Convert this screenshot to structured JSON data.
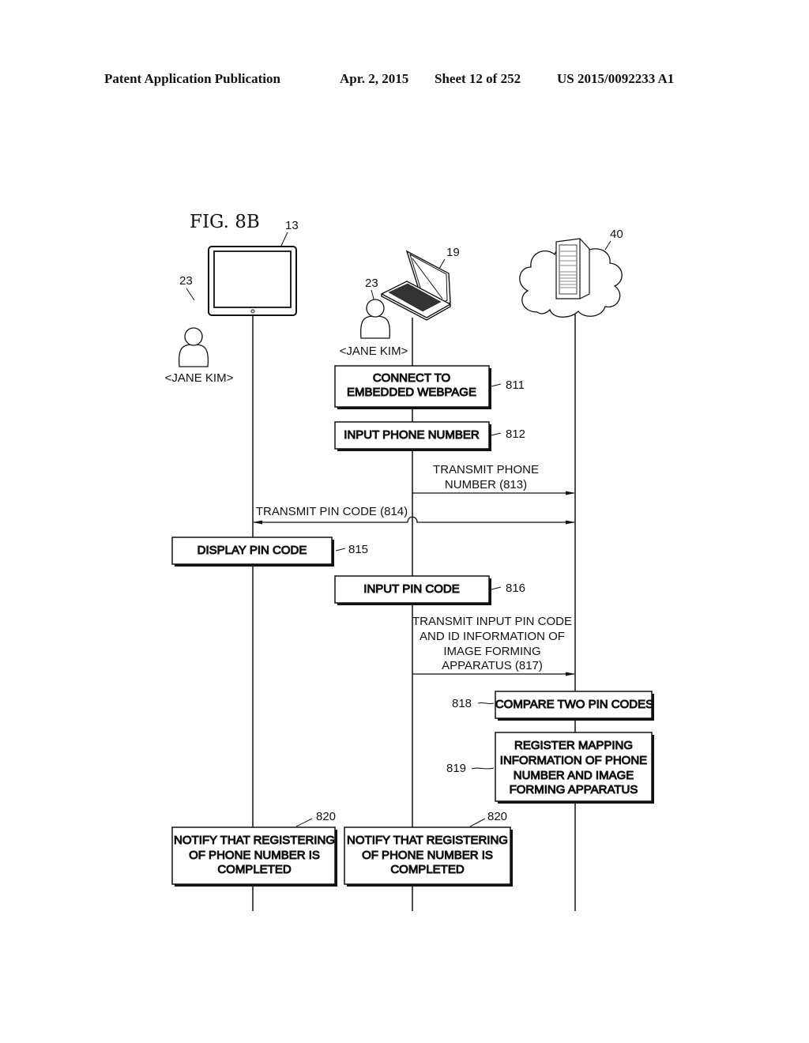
{
  "header": {
    "publication": "Patent Application Publication",
    "date": "Apr. 2, 2015",
    "sheet": "Sheet 12 of 252",
    "patent_number": "US 2015/0092233 A1"
  },
  "figure": {
    "title": "FIG.  8B",
    "entities": {
      "tablet": {
        "ref": "13"
      },
      "laptop": {
        "ref": "19"
      },
      "server": {
        "ref": "40"
      },
      "user_left": {
        "ref": "23",
        "name": "<JANE KIM>"
      },
      "user_mid": {
        "ref": "23",
        "name": "<JANE KIM>"
      }
    },
    "steps": {
      "s811": {
        "ref": "811",
        "lines": [
          "CONNECT TO",
          "EMBEDDED WEBPAGE"
        ]
      },
      "s812": {
        "ref": "812",
        "lines": [
          "INPUT PHONE NUMBER"
        ]
      },
      "s813": {
        "lines": [
          "TRANSMIT PHONE",
          "NUMBER (813)"
        ]
      },
      "s814": {
        "lines": [
          "TRANSMIT PIN CODE (814)"
        ]
      },
      "s815": {
        "ref": "815",
        "lines": [
          "DISPLAY PIN CODE"
        ]
      },
      "s816": {
        "ref": "816",
        "lines": [
          "INPUT PIN CODE"
        ]
      },
      "s817": {
        "lines": [
          "TRANSMIT INPUT PIN CODE",
          "AND ID INFORMATION OF",
          "IMAGE FORMING",
          "APPARATUS (817)"
        ]
      },
      "s818": {
        "ref": "818",
        "lines": [
          "COMPARE TWO PIN CODES"
        ]
      },
      "s819": {
        "ref": "819",
        "lines": [
          "REGISTER MAPPING",
          "INFORMATION OF PHONE",
          "NUMBER AND IMAGE",
          "FORMING APPARATUS"
        ]
      },
      "s820a": {
        "ref": "820",
        "lines": [
          "NOTIFY THAT REGISTERING",
          "OF PHONE NUMBER IS",
          "COMPLETED"
        ]
      },
      "s820b": {
        "ref": "820",
        "lines": [
          "NOTIFY THAT REGISTERING",
          "OF PHONE NUMBER IS",
          "COMPLETED"
        ]
      }
    }
  }
}
